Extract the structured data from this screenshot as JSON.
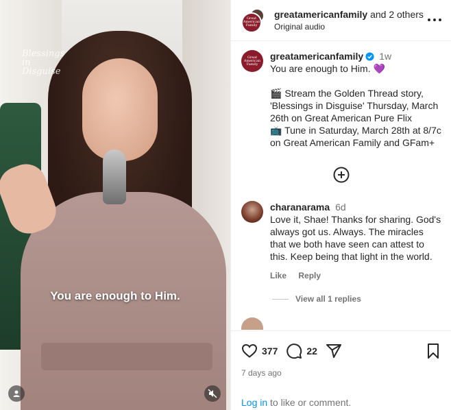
{
  "media": {
    "watermark": "Blessings in Disguise",
    "caption": "You are enough to Him."
  },
  "header": {
    "username": "greatamericanfamily",
    "others": "and 2 others",
    "subtitle": "Original audio",
    "avatar_text": "Great American Family"
  },
  "post": {
    "username": "greatamericanfamily",
    "time": "1w",
    "text": "You are enough to Him. 💜\n\n🎬 Stream the Golden Thread story, 'Blessings in Disguise' Thursday, March 26th on Great American Pure Flix\n📺 Tune in Saturday, March 28th at 8/7c on Great American Family and GFam+"
  },
  "comment": {
    "username": "charanarama",
    "time": "6d",
    "text": "Love it, Shae! Thanks for sharing. God's always got us. Always. The miracles that we both have seen can attest to this. Keep being that light in the world.",
    "like_label": "Like",
    "reply_label": "Reply",
    "view_replies": "View all 1 replies"
  },
  "actions": {
    "likes": "377",
    "comments": "22",
    "posted_ago": "7 days ago",
    "login_link": "Log in",
    "login_rest": " to like or comment."
  },
  "colors": {
    "brand": "#8a1c2b",
    "link": "#0095f6",
    "muted": "#737373",
    "verified": "#0095f6"
  }
}
